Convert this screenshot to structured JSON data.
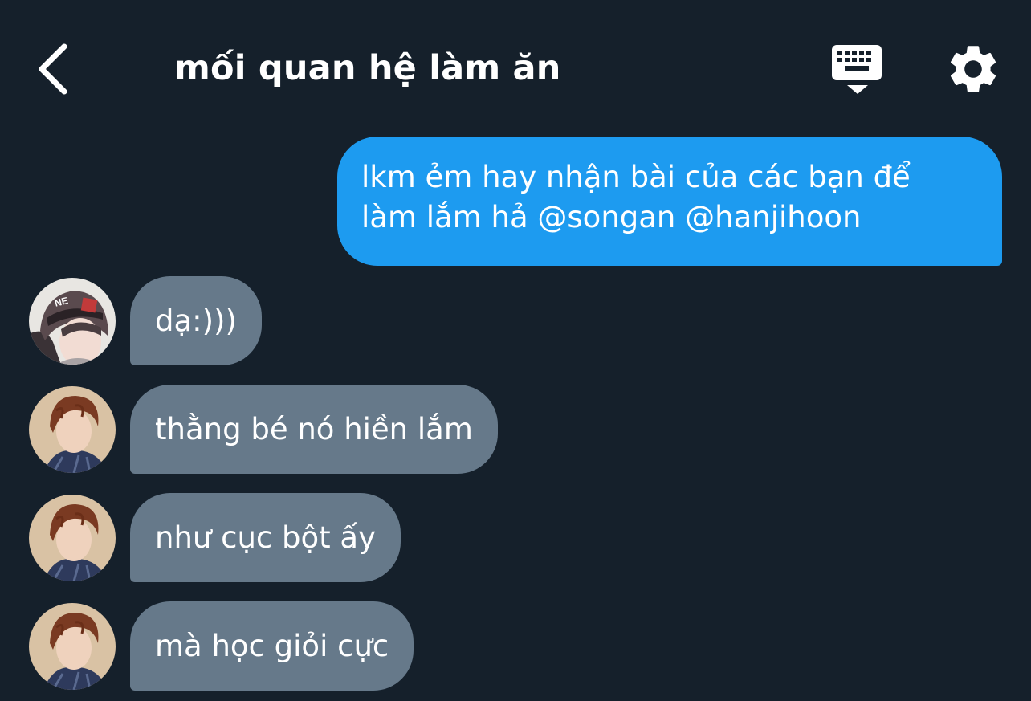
{
  "header": {
    "back_icon": "chevron-left-icon",
    "title": "mối quan hệ làm ăn",
    "keyboard_icon": "keyboard-icon",
    "settings_icon": "gear-icon"
  },
  "messages": [
    {
      "direction": "outgoing",
      "lines": [
        "lkm ẻm hay nhận bài của các bạn để",
        "làm lắm hả @songan @hanjihoon"
      ]
    },
    {
      "direction": "incoming",
      "avatar": "avatar-user-hat",
      "text": "dạ:)))"
    },
    {
      "direction": "incoming",
      "avatar": "avatar-user-brown-hair",
      "text": "thằng bé nó hiền lắm"
    },
    {
      "direction": "incoming",
      "avatar": "avatar-user-brown-hair",
      "text": "như cục bột ấy"
    },
    {
      "direction": "incoming",
      "avatar": "avatar-user-brown-hair",
      "text": "mà học giỏi cực"
    }
  ],
  "colors": {
    "background": "#15202b",
    "outgoing_bubble": "#1d9bf0",
    "incoming_bubble": "#66798a",
    "text": "#ffffff"
  }
}
